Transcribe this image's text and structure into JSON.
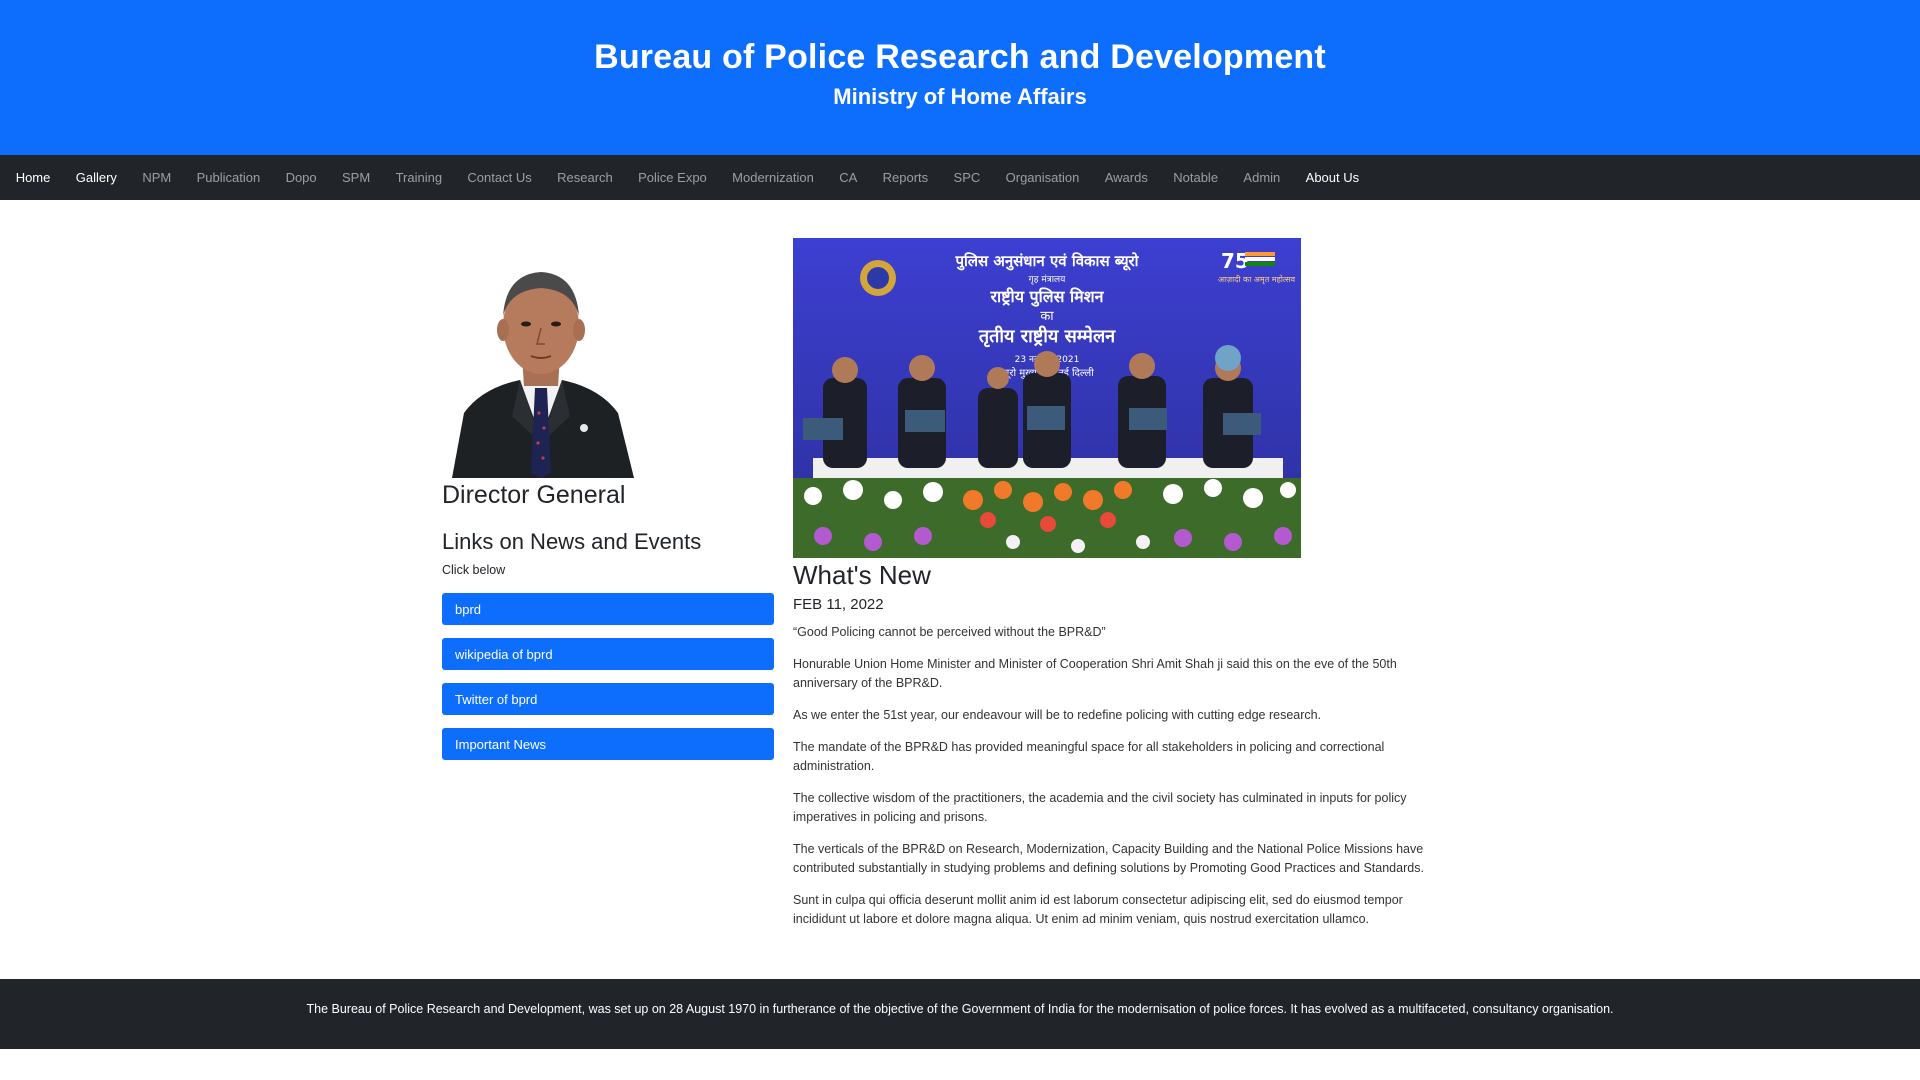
{
  "header": {
    "title": "Bureau of Police Research and Development",
    "subtitle": "Ministry of Home Affairs"
  },
  "nav": {
    "items": [
      {
        "label": "Home",
        "active": true
      },
      {
        "label": "Gallery",
        "active": true
      },
      {
        "label": "NPM",
        "active": false
      },
      {
        "label": "Publication",
        "active": false
      },
      {
        "label": "Dopo",
        "active": false
      },
      {
        "label": "SPM",
        "active": false
      },
      {
        "label": "Training",
        "active": false
      },
      {
        "label": "Contact Us",
        "active": false
      },
      {
        "label": "Research",
        "active": false
      },
      {
        "label": "Police Expo",
        "active": false
      },
      {
        "label": "Modernization",
        "active": false
      },
      {
        "label": "CA",
        "active": false
      },
      {
        "label": "Reports",
        "active": false
      },
      {
        "label": "SPC",
        "active": false
      },
      {
        "label": "Organisation",
        "active": false
      },
      {
        "label": "Awards",
        "active": false
      },
      {
        "label": "Notable",
        "active": false
      },
      {
        "label": "Admin",
        "active": false
      },
      {
        "label": "About Us",
        "active": true
      }
    ]
  },
  "left": {
    "dg_title": "Director General",
    "links_title": "Links on News and Events",
    "click_below": "Click below",
    "links": [
      "bprd",
      "wikipedia of bprd",
      "Twitter of bprd",
      "Important News"
    ]
  },
  "right": {
    "banner_text": {
      "line1": "पुलिस अनुसंधान एवं विकास ब्यूरो",
      "line2": "गृह मंत्रालय",
      "line3": "राष्ट्रीय पुलिस मिशन",
      "line4": "का",
      "line5": "तृतीय राष्ट्रीय सम्मेलन",
      "line6": "23 नवम्बर, 2021",
      "line7": "ब्यूरो मुख्यालय, नई दिल्ली",
      "logo_text": "75",
      "logo_sub": "आज़ादी का अमृत महोत्सव"
    },
    "whats_new": "What's New",
    "date": "FEB 11, 2022",
    "paragraphs": [
      "“Good Policing cannot be perceived without the BPR&D”",
      "Honurable Union Home Minister and Minister of Cooperation Shri Amit Shah ji said this on the eve of the 50th anniversary of the BPR&D.",
      "As we enter the 51st year, our endeavour will be to redefine policing with cutting edge research.",
      "The mandate of the BPR&D has provided meaningful space for all stakeholders in policing and correctional administration.",
      "The collective wisdom of the practitioners, the academia and the civil society has culminated in inputs for policy imperatives in policing and prisons.",
      "The verticals of the BPR&D on Research, Modernization, Capacity Building and the National Police Missions have contributed substantially in studying problems and defining solutions by Promoting Good Practices and Standards.",
      "Sunt in culpa qui officia deserunt mollit anim id est laborum consectetur adipiscing elit, sed do eiusmod tempor incididunt ut labore et dolore magna aliqua. Ut enim ad minim veniam, quis nostrud exercitation ullamco."
    ]
  },
  "footer": {
    "text": "The Bureau of Police Research and Development, was set up on 28 August 1970 in furtherance of the objective of the Government of India for the modernisation of police forces. It has evolved as a multifaceted, consultancy organisation."
  },
  "colors": {
    "primary": "#0d6efd",
    "navbar": "#212529",
    "footer": "#212529",
    "event_backdrop": "#3a3fbf"
  }
}
